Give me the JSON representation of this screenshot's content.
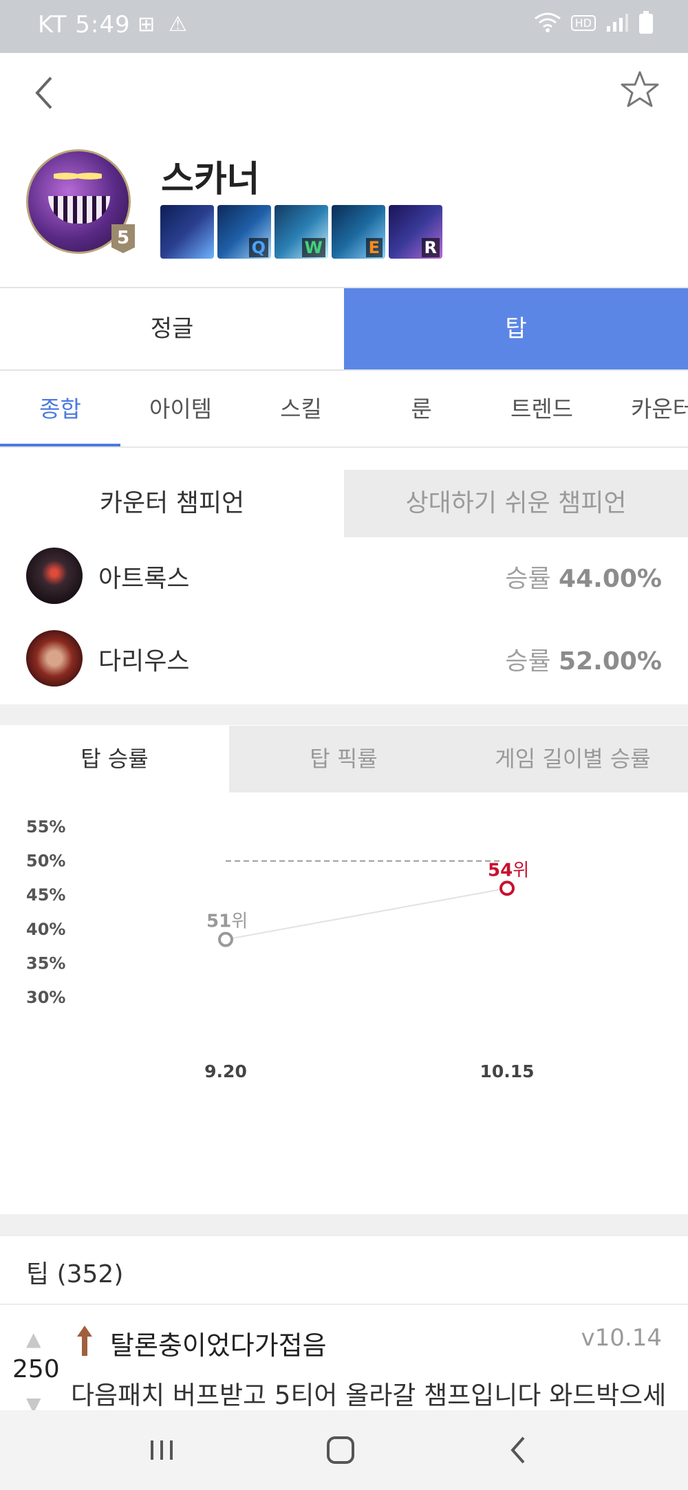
{
  "status_bar": {
    "carrier_time": "KT 5:49"
  },
  "header": {
    "champion_name": "스카너",
    "level": "5",
    "skills": [
      {
        "key": "",
        "color": "#2a3f8f"
      },
      {
        "key": "Q",
        "color": "#1f5fa8",
        "key_color": "#4aa3ff"
      },
      {
        "key": "W",
        "color": "#2a7fb3",
        "key_color": "#44d17a"
      },
      {
        "key": "E",
        "color": "#1d6aa0",
        "key_color": "#ff8a1e"
      },
      {
        "key": "R",
        "color": "#3a3a9a",
        "key_color": "#ffffff"
      }
    ]
  },
  "lane_tabs": {
    "jungle": "정글",
    "top": "탑"
  },
  "sub_tabs": [
    "종합",
    "아이템",
    "스킬",
    "룬",
    "트렌드",
    "카운터"
  ],
  "counter": {
    "tab_counter": "카운터 챔피언",
    "tab_easy": "상대하기 쉬운 챔피언",
    "rows": [
      {
        "name": "아트록스",
        "rate_label": "승률",
        "rate": "44.00%"
      },
      {
        "name": "다리우스",
        "rate_label": "승률",
        "rate": "52.00%"
      }
    ]
  },
  "graph_tabs": [
    "탑 승률",
    "탑 픽률",
    "게임 길이별 승률"
  ],
  "chart_data": {
    "type": "line",
    "y_ticks": [
      "55%",
      "50%",
      "45%",
      "40%",
      "35%",
      "30%"
    ],
    "ylim": [
      30,
      55
    ],
    "reference_line": 50,
    "points": [
      {
        "x": "9.20",
        "y": 38.5,
        "rank": "51",
        "rank_suffix": "위",
        "color": "#999999"
      },
      {
        "x": "10.15",
        "y": 46.0,
        "rank": "54",
        "rank_suffix": "위",
        "color": "#c8102e"
      }
    ]
  },
  "tips": {
    "title": "팁 (352)",
    "item": {
      "votes": "250",
      "user": "탈론충이었다가접음",
      "version": "v10.14",
      "text": "다음패치 버프받고 5티어 올라갈 챔프입니다 와드박으세"
    }
  }
}
